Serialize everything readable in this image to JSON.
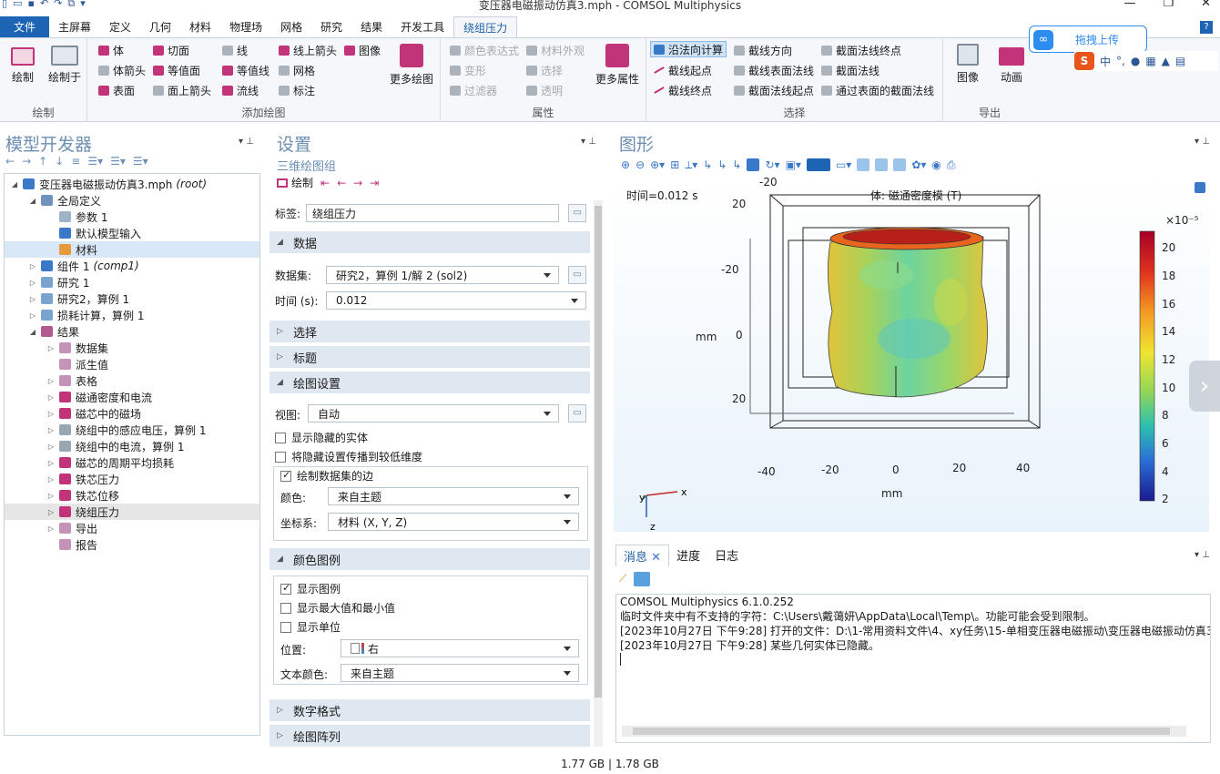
{
  "window": {
    "title": "变压器电磁振动仿真3.mph - COMSOL Multiphysics"
  },
  "ribbon_tabs": [
    "文件",
    "主屏幕",
    "定义",
    "几何",
    "材料",
    "物理场",
    "网格",
    "研究",
    "结果",
    "开发工具",
    "绕组压力"
  ],
  "ribbon": {
    "draw": {
      "draw": "绘制",
      "draw_into": "绘制于",
      "label": "绘制"
    },
    "add_plot": {
      "volume": "体",
      "volume_arrow": "体箭头",
      "surface": "表面",
      "slice": "切面",
      "isosurface": "等值面",
      "surface_arrow": "面上箭头",
      "line": "线",
      "contour": "等值线",
      "streamline": "流线",
      "line_arrow": "线上箭头",
      "mesh": "网格",
      "annotation": "标注",
      "image": "图像",
      "more_plots": "更多绘图",
      "label": "添加绘图"
    },
    "attributes": {
      "color_expr": "颜色表达式",
      "material_appearance": "材料外观",
      "deformation": "变形",
      "selection": "选择",
      "filter": "过滤器",
      "transparency": "透明",
      "more_attributes": "更多属性",
      "label": "属性"
    },
    "select": {
      "compute_along_line": "沿法向计算",
      "line_start": "截线起点",
      "line_end": "截线终点",
      "line_direction": "截线方向",
      "line_surface_normal": "截线表面法线",
      "section_normal_start": "截面法线起点",
      "section_normal_end": "截面法线终点",
      "section_normal": "截面法线",
      "section_normal_through_surface": "通过表面的截面法线",
      "label": "选择"
    },
    "export": {
      "image": "图像",
      "animation": "动画",
      "label": "导出"
    }
  },
  "overlay": {
    "baidu_upload": "拖拽上传",
    "ime_lang": "中"
  },
  "model_builder": {
    "title": "模型开发器",
    "tree": [
      {
        "label": "变压器电磁振动仿真3.mph",
        "suffix": "(root)",
        "level": 0,
        "arrow": "◢",
        "icon": "#3a78c9"
      },
      {
        "label": "全局定义",
        "level": 1,
        "arrow": "◢",
        "icon": "#6f93bd"
      },
      {
        "label": "参数 1",
        "level": 2,
        "arrow": "",
        "icon": "#9fb3c8"
      },
      {
        "label": "默认模型输入",
        "level": 2,
        "arrow": "",
        "icon": "#3a78c9"
      },
      {
        "label": "材料",
        "level": 2,
        "arrow": "",
        "icon": "#e79a3a",
        "selected": true
      },
      {
        "label": "组件 1",
        "suffix": "(comp1)",
        "level": 1,
        "arrow": "▷",
        "icon": "#3a78c9"
      },
      {
        "label": "研究 1",
        "level": 1,
        "arrow": "▷",
        "icon": "#79a4cf"
      },
      {
        "label": "研究2，算例 1",
        "level": 1,
        "arrow": "▷",
        "icon": "#79a4cf"
      },
      {
        "label": "损耗计算，算例 1",
        "level": 1,
        "arrow": "▷",
        "icon": "#79a4cf"
      },
      {
        "label": "结果",
        "level": 1,
        "arrow": "◢",
        "icon": "#b05a8f"
      },
      {
        "label": "数据集",
        "level": 2,
        "arrow": "▷",
        "icon": "#c493b7"
      },
      {
        "label": "派生值",
        "level": 2,
        "arrow": "",
        "icon": "#c493b7"
      },
      {
        "label": "表格",
        "level": 2,
        "arrow": "▷",
        "icon": "#c493b7"
      },
      {
        "label": "磁通密度和电流",
        "level": 2,
        "arrow": "▷",
        "icon": "#c2347a"
      },
      {
        "label": "磁芯中的磁场",
        "level": 2,
        "arrow": "▷",
        "icon": "#c2347a"
      },
      {
        "label": "绕组中的感应电压，算例 1",
        "level": 2,
        "arrow": "▷",
        "icon": "#9aa6b2"
      },
      {
        "label": "绕组中的电流，算例 1",
        "level": 2,
        "arrow": "▷",
        "icon": "#9aa6b2"
      },
      {
        "label": "磁芯的周期平均损耗",
        "level": 2,
        "arrow": "▷",
        "icon": "#c2347a"
      },
      {
        "label": "铁芯压力",
        "level": 2,
        "arrow": "▷",
        "icon": "#c2347a"
      },
      {
        "label": "铁芯位移",
        "level": 2,
        "arrow": "▷",
        "icon": "#c2347a"
      },
      {
        "label": "绕组压力",
        "level": 2,
        "arrow": "▷",
        "icon": "#c2347a",
        "current": true
      },
      {
        "label": "导出",
        "level": 2,
        "arrow": "▷",
        "icon": "#c493b7"
      },
      {
        "label": "报告",
        "level": 2,
        "arrow": "",
        "icon": "#c493b7"
      }
    ]
  },
  "settings": {
    "title": "设置",
    "subtitle": "三维绘图组",
    "draw": "绘制",
    "label_label": "标签:",
    "label_value": "绕组压力",
    "data_section": "数据",
    "dataset_label": "数据集:",
    "dataset_value": "研究2，算例 1/解 2 (sol2)",
    "time_label": "时间 (s):",
    "time_value": "0.012",
    "selection_section": "选择",
    "title_section": "标题",
    "plot_settings_section": "绘图设置",
    "view_label": "视图:",
    "view_value": "自动",
    "show_hidden": "显示隐藏的实体",
    "propagate_hiding": "将隐藏设置传播到较低维度",
    "plot_dataset_edges": "绘制数据集的边",
    "color_label": "颜色:",
    "color_value": "来自主题",
    "frame_label": "坐标系:",
    "frame_value": "材料  (X, Y, Z)",
    "legend_section": "颜色图例",
    "show_legend": "显示图例",
    "show_maxmin": "显示最大值和最小值",
    "show_units": "显示单位",
    "position_label": "位置:",
    "position_value": "右",
    "text_color_label": "文本颜色:",
    "text_color_value": "来自主题",
    "number_format_section": "数字格式",
    "plot_array_section": "绘图阵列"
  },
  "graphics": {
    "title": "图形",
    "time_label": "时间=0.012 s",
    "plot_title": "体: 磁通密度模 (T)",
    "axis_unit": "mm",
    "x_ticks": [
      "-40",
      "-20",
      "0",
      "20",
      "40"
    ],
    "y_ticks": [
      "-20",
      "20",
      "-20",
      "0",
      "20"
    ],
    "colorbar": {
      "exponent": "×10⁻⁵",
      "ticks": [
        "20",
        "18",
        "16",
        "14",
        "12",
        "10",
        "8",
        "6",
        "4",
        "2"
      ]
    },
    "triad": {
      "x": "x",
      "y": "y",
      "z": "z"
    }
  },
  "messages": {
    "tabs": [
      "消息",
      "进度",
      "日志"
    ],
    "lines": [
      "COMSOL Multiphysics 6.1.0.252",
      "临时文件夹中有不支持的字符：C:\\Users\\戴蔼妍\\AppData\\Local\\Temp\\。功能可能会受到限制。",
      "[2023年10月27日 下午9:28] 打开的文件：D:\\1-常用资料文件\\4、xy任务\\15-单相变压器电磁振动\\变压器电磁振动仿真3.",
      "[2023年10月27日 下午9:28] 某些几何实体已隐藏。"
    ]
  },
  "status": {
    "memory": "1.77 GB | 1.78 GB"
  }
}
